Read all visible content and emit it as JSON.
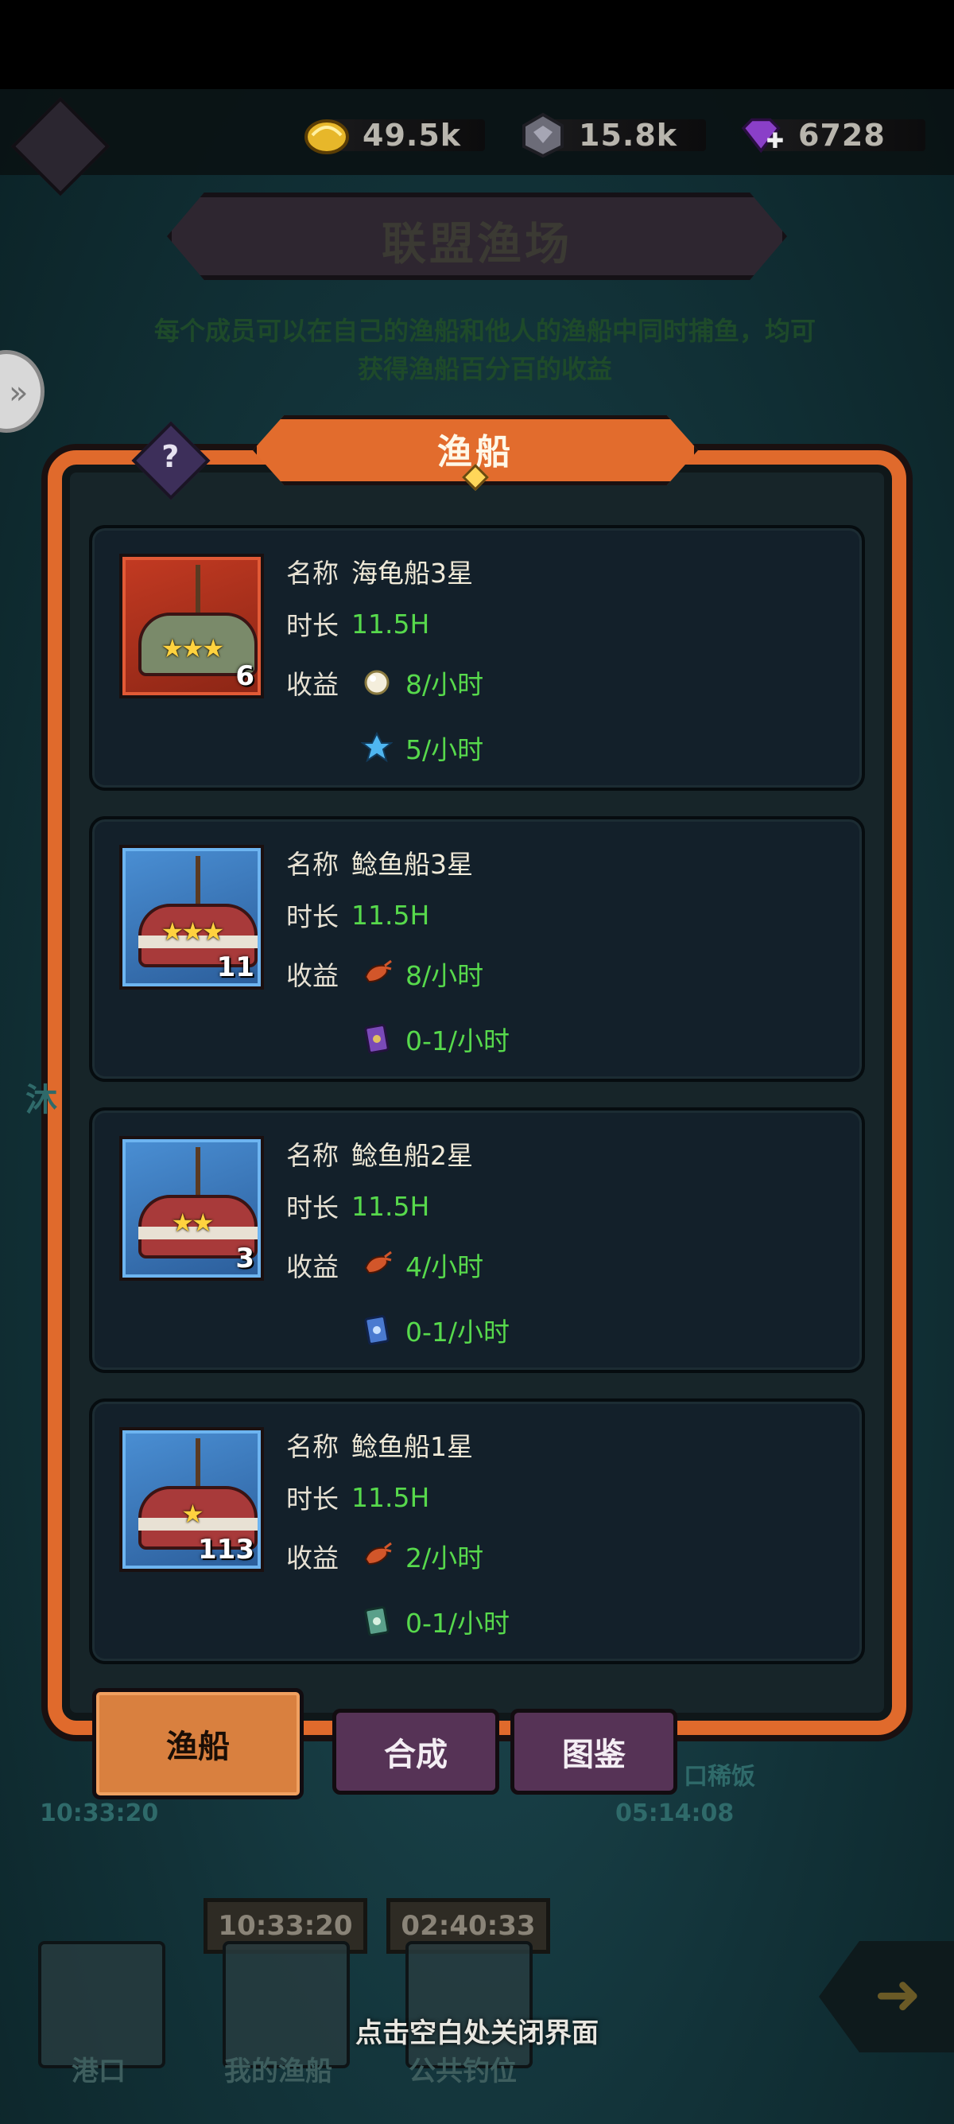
{
  "hud": {
    "currencies": [
      {
        "icon": "gold-shell-icon",
        "value": "49.5k"
      },
      {
        "icon": "silver-gem-icon",
        "value": "15.8k"
      },
      {
        "icon": "purple-diamond-plus-icon",
        "value": "6728"
      }
    ]
  },
  "title": "联盟渔场",
  "subtitle": "每个成员可以在自己的渔船和他人的渔船中同时捕鱼，均可获得渔船百分百的收益",
  "panel": {
    "header_tab": "渔船",
    "labels": {
      "name": "名称",
      "duration": "时长",
      "income": "收益"
    },
    "boats": [
      {
        "theme": "red",
        "stars": "★★★",
        "count": "6",
        "name": "海龟船3星",
        "duration": "11.5H",
        "income": [
          {
            "icon": "pearl-icon",
            "value": "8/小时"
          },
          {
            "icon": "blue-crystal-icon",
            "value": "5/小时"
          }
        ]
      },
      {
        "theme": "blue",
        "stars": "★★★",
        "count": "11",
        "name": "鲶鱼船3星",
        "duration": "11.5H",
        "income": [
          {
            "icon": "shrimp-icon",
            "value": "8/小时"
          },
          {
            "icon": "purple-card-icon",
            "value": "0-1/小时"
          }
        ]
      },
      {
        "theme": "blue",
        "stars": "★★",
        "count": "3",
        "name": "鲶鱼船2星",
        "duration": "11.5H",
        "income": [
          {
            "icon": "shrimp-icon",
            "value": "4/小时"
          },
          {
            "icon": "blue-card-icon",
            "value": "0-1/小时"
          }
        ]
      },
      {
        "theme": "blue",
        "stars": "★",
        "count": "113",
        "name": "鲶鱼船1星",
        "duration": "11.5H",
        "income": [
          {
            "icon": "shrimp-icon",
            "value": "2/小时"
          },
          {
            "icon": "green-card-icon",
            "value": "0-1/小时"
          }
        ]
      }
    ]
  },
  "tabs": {
    "boat": "渔船",
    "synth": "合成",
    "codex": "图鉴"
  },
  "background": {
    "left_timer": "10:33:20",
    "right_timer": "05:14:08",
    "right_name": "口稀饭",
    "bottom_timer_1": "10:33:20",
    "bottom_timer_2": "02:40:33",
    "bottom_labels": [
      "港口",
      "我的渔船",
      "公共钓位"
    ],
    "left_char": "沐"
  },
  "close_hint": "点击空白处关闭界面"
}
